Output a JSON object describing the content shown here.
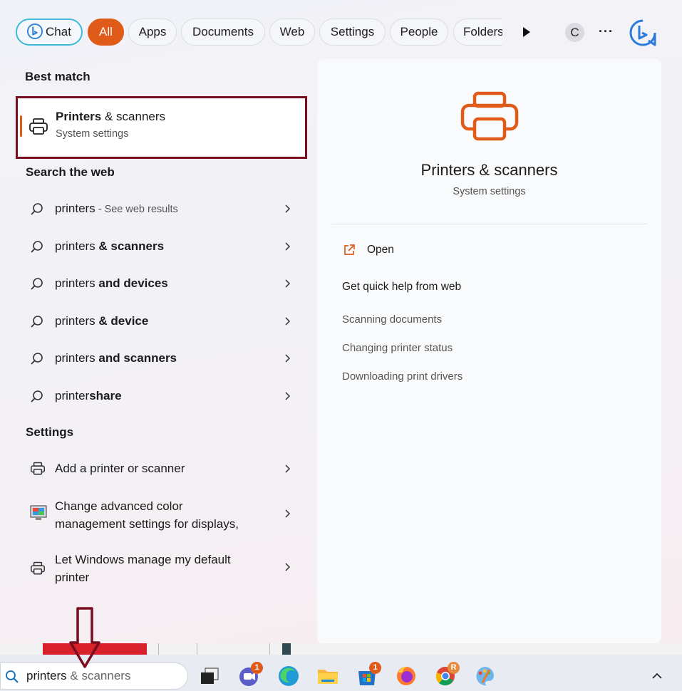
{
  "filters": {
    "chat": "Chat",
    "tabs": [
      "All",
      "Apps",
      "Documents",
      "Web",
      "Settings",
      "People",
      "Folders"
    ],
    "active": "All",
    "account_initial": "C",
    "more": "···"
  },
  "best_match": {
    "heading": "Best match",
    "title_bold": "Printers",
    "title_rest": " & scanners",
    "subtitle": "System settings"
  },
  "web": {
    "heading": "Search the web",
    "items": [
      {
        "prefix": "printers",
        "bold": "",
        "suffix": " - See web results"
      },
      {
        "prefix": "printers",
        "bold": " & scanners",
        "suffix": ""
      },
      {
        "prefix": "printers",
        "bold": " and devices",
        "suffix": ""
      },
      {
        "prefix": "printers",
        "bold": " & device",
        "suffix": ""
      },
      {
        "prefix": "printers",
        "bold": " and scanners",
        "suffix": ""
      },
      {
        "prefix": "printer",
        "bold": "share",
        "suffix": ""
      }
    ]
  },
  "settings": {
    "heading": "Settings",
    "items": [
      {
        "line1": "Add a printer or scanner",
        "line2": ""
      },
      {
        "line1": "Change advanced color",
        "line2": "management settings for displays,"
      },
      {
        "line1": "Let Windows manage my default",
        "line2": "printer"
      }
    ]
  },
  "detail": {
    "title": "Printers & scanners",
    "subtitle": "System settings",
    "open": "Open",
    "quick_help": "Get quick help from web",
    "links": [
      "Scanning documents",
      "Changing printer status",
      "Downloading print drivers"
    ]
  },
  "taskbar": {
    "search_typed": "printers",
    "search_rest": " & scanners",
    "badges": [
      "1",
      "1",
      "R"
    ]
  },
  "colors": {
    "accent": "#e05a1a",
    "highlight_border": "#7a0c1f"
  }
}
